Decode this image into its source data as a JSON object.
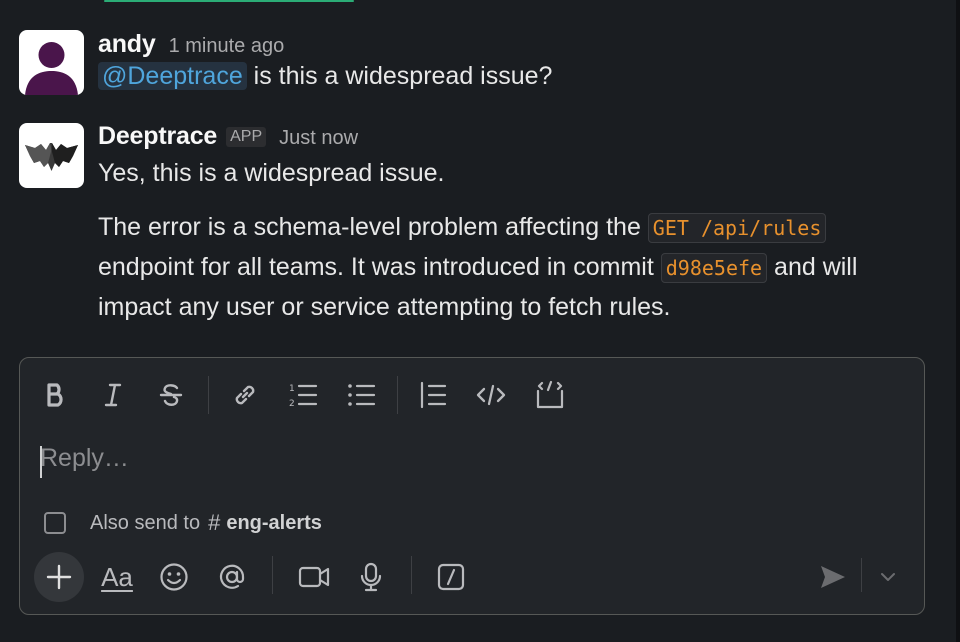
{
  "messages": [
    {
      "author": "andy",
      "timestamp": "1 minute ago",
      "mention": "@Deeptrace",
      "text": " is this a widespread issue?"
    },
    {
      "author": "Deeptrace",
      "badge": "APP",
      "timestamp": "Just now",
      "para1": "Yes, this is a widespread issue.",
      "para2_a": "The error is a schema-level problem affecting the ",
      "code1": "GET /api/rules",
      "para2_b": "endpoint for all teams. It was introduced in commit ",
      "code2": "d98e5efe",
      "para2_c": " and will",
      "para2_d": "impact any user or service attempting to fetch rules."
    }
  ],
  "composer": {
    "placeholder": "Reply…",
    "also_send_label": "Also send to",
    "channel_hash": "#",
    "channel_name": "eng-alerts",
    "format_label": "Aa",
    "plus_label": "+"
  },
  "icons": {
    "toolbar": [
      "bold-icon",
      "italic-icon",
      "strikethrough-icon",
      "link-icon",
      "ordered-list-icon",
      "bulleted-list-icon",
      "blockquote-icon",
      "code-icon",
      "code-block-icon"
    ],
    "bottom": [
      "plus-icon",
      "format-icon",
      "emoji-icon",
      "mention-icon",
      "video-icon",
      "microphone-icon",
      "slash-command-icon",
      "send-icon",
      "chevron-down-icon"
    ]
  },
  "colors": {
    "background": "#1a1d21",
    "mention": "#4fa5dc",
    "code": "#e8912d",
    "avatar_andy_bg": "#ffffff",
    "avatar_andy_fg": "#4a154b"
  }
}
